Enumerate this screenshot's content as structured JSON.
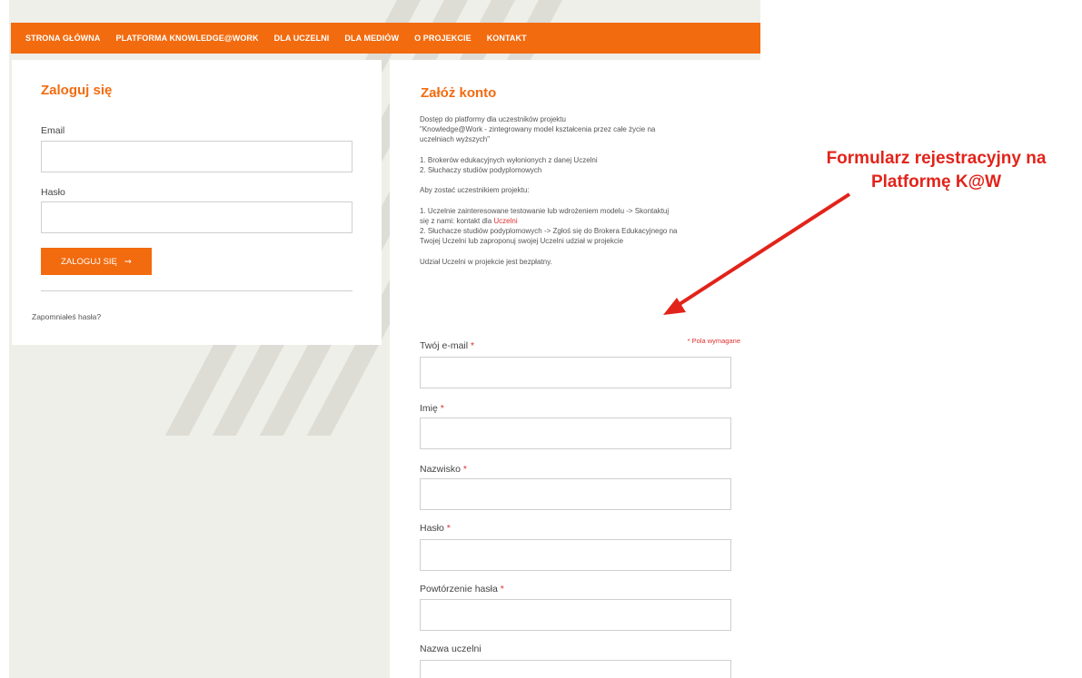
{
  "nav": {
    "items": [
      "STRONA GŁÓWNA",
      "PLATFORMA KNOWLEDGE@WORK",
      "DLA UCZELNI",
      "DLA MEDIÓW",
      "O PROJEKCIE",
      "KONTAKT"
    ]
  },
  "login": {
    "title": "Zaloguj się",
    "email_label": "Email",
    "password_label": "Hasło",
    "button_label": "ZALOGUJ SIĘ",
    "forgot_link": "Zapomniałeś hasła?"
  },
  "register": {
    "title": "Załóż konto",
    "intro_line1": "Dostęp do platformy dla uczestników projektu",
    "intro_line2": "\"Knowledge@Work - zintegrowany model kształcenia przez całe życie na",
    "intro_line3": "uczelniach wyższych\"",
    "list1_line": "1. Brokerów edukacyjnych wyłonionych z danej Uczelni",
    "list2_line": "2. Słuchaczy studiów podyplomowych",
    "howto": "Aby zostać uczestnikiem projektu:",
    "step1_line1": "1. Uczelnie zainteresowane testowanie lub wdrożeniem modelu -> Skontaktuj",
    "step1_line2_prefix": "się z nami: kontakt dla ",
    "step1_link": "Uczelni",
    "step2_line1": "2. Słuchacze studiów podyplomowych -> Zgłoś się do Brokera Edukacyjnego na",
    "step2_line2": "Twojej Uczelni lub zaproponuj swojej Uczelni udział w projekcie",
    "free_note": "Udział Uczelni w projekcie jest bezpłatny.",
    "required_note": "* Pola wymagane",
    "required_mark": "*",
    "fields": {
      "email": "Twój e-mail",
      "first_name": "Imię",
      "last_name": "Nazwisko",
      "password": "Hasło",
      "password_repeat": "Powtórzenie hasła",
      "university": "Nazwa uczelni"
    }
  },
  "annotation": {
    "line1": "Formularz rejestracyjny na",
    "line2": "Platformę K@W",
    "color": "#e2231a"
  },
  "colors": {
    "accent": "#f26b0f",
    "required": "#e0302c"
  }
}
